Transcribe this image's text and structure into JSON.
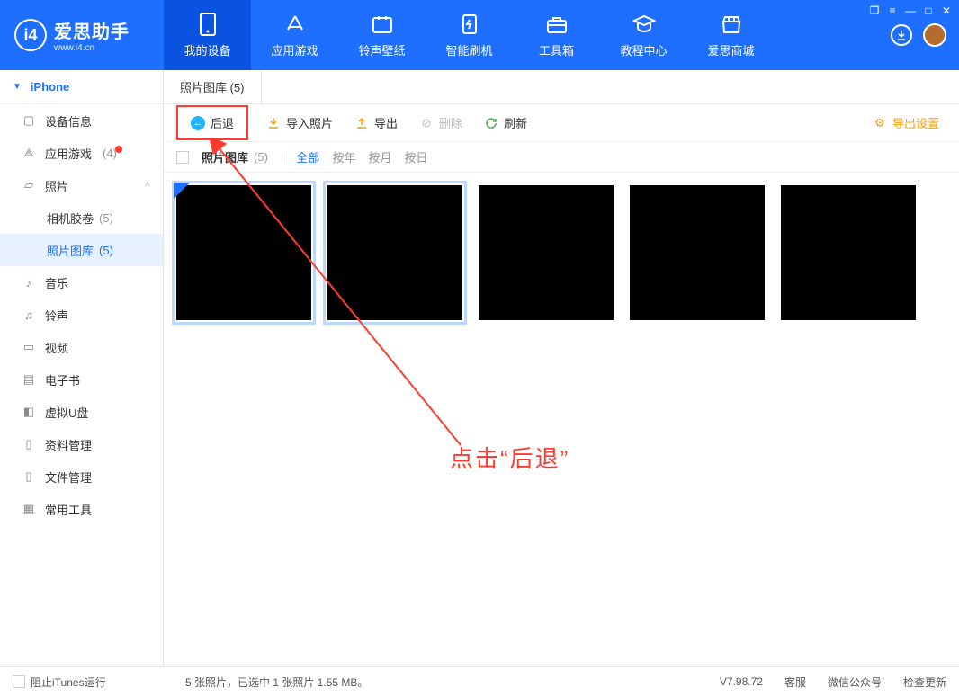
{
  "logo": {
    "cn": "爱思助手",
    "url": "www.i4.cn",
    "mark": "i4"
  },
  "topnav": [
    {
      "label": "我的设备"
    },
    {
      "label": "应用游戏"
    },
    {
      "label": "铃声壁纸"
    },
    {
      "label": "智能刷机"
    },
    {
      "label": "工具箱"
    },
    {
      "label": "教程中心"
    },
    {
      "label": "爱思商城"
    }
  ],
  "sidebar": {
    "device": "iPhone",
    "items": {
      "info": "设备信息",
      "apps": "应用游戏",
      "apps_count": "(4)",
      "photos": "照片",
      "camera_roll": "相机胶卷",
      "camera_roll_count": "(5)",
      "photo_lib": "照片图库",
      "photo_lib_count": "(5)",
      "music": "音乐",
      "ringtone": "铃声",
      "video": "视频",
      "ebook": "电子书",
      "udisk": "虚拟U盘",
      "data": "资料管理",
      "files": "文件管理",
      "tools": "常用工具"
    }
  },
  "tab": {
    "title": "照片图库 (5)"
  },
  "toolbar": {
    "back": "后退",
    "import": "导入照片",
    "export": "导出",
    "delete": "删除",
    "refresh": "刷新",
    "export_settings": "导出设置"
  },
  "filter": {
    "label": "照片图库",
    "count": "(5)",
    "all": "全部",
    "year": "按年",
    "month": "按月",
    "day": "按日"
  },
  "annotation": "点击“后退”",
  "status": {
    "block_itunes": "阻止iTunes运行",
    "summary": "5 张照片，已选中 1 张照片 1.55 MB。",
    "version": "V7.98.72",
    "kefu": "客服",
    "wx": "微信公众号",
    "update": "检查更新"
  }
}
